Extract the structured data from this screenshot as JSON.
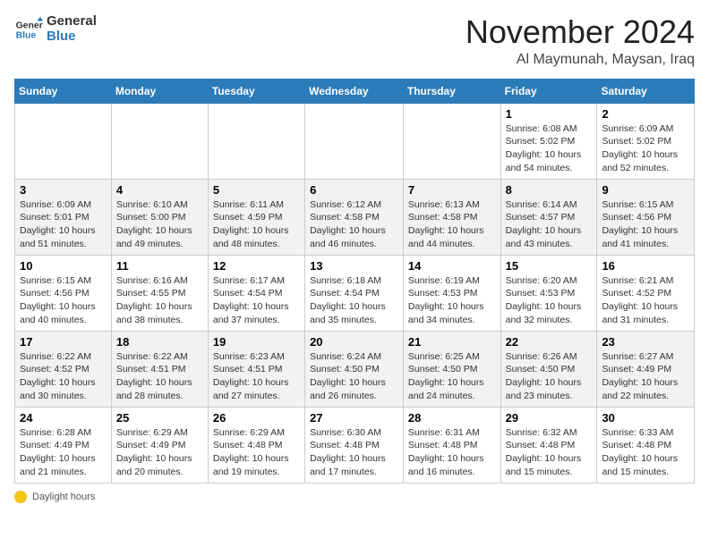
{
  "logo": {
    "line1": "General",
    "line2": "Blue"
  },
  "title": "November 2024",
  "location": "Al Maymunah, Maysan, Iraq",
  "days_of_week": [
    "Sunday",
    "Monday",
    "Tuesday",
    "Wednesday",
    "Thursday",
    "Friday",
    "Saturday"
  ],
  "footer": {
    "icon_label": "sun-icon",
    "text": "Daylight hours"
  },
  "weeks": [
    {
      "days": [
        {
          "num": "",
          "info": ""
        },
        {
          "num": "",
          "info": ""
        },
        {
          "num": "",
          "info": ""
        },
        {
          "num": "",
          "info": ""
        },
        {
          "num": "",
          "info": ""
        },
        {
          "num": "1",
          "info": "Sunrise: 6:08 AM\nSunset: 5:02 PM\nDaylight: 10 hours and 54 minutes."
        },
        {
          "num": "2",
          "info": "Sunrise: 6:09 AM\nSunset: 5:02 PM\nDaylight: 10 hours and 52 minutes."
        }
      ]
    },
    {
      "days": [
        {
          "num": "3",
          "info": "Sunrise: 6:09 AM\nSunset: 5:01 PM\nDaylight: 10 hours and 51 minutes."
        },
        {
          "num": "4",
          "info": "Sunrise: 6:10 AM\nSunset: 5:00 PM\nDaylight: 10 hours and 49 minutes."
        },
        {
          "num": "5",
          "info": "Sunrise: 6:11 AM\nSunset: 4:59 PM\nDaylight: 10 hours and 48 minutes."
        },
        {
          "num": "6",
          "info": "Sunrise: 6:12 AM\nSunset: 4:58 PM\nDaylight: 10 hours and 46 minutes."
        },
        {
          "num": "7",
          "info": "Sunrise: 6:13 AM\nSunset: 4:58 PM\nDaylight: 10 hours and 44 minutes."
        },
        {
          "num": "8",
          "info": "Sunrise: 6:14 AM\nSunset: 4:57 PM\nDaylight: 10 hours and 43 minutes."
        },
        {
          "num": "9",
          "info": "Sunrise: 6:15 AM\nSunset: 4:56 PM\nDaylight: 10 hours and 41 minutes."
        }
      ]
    },
    {
      "days": [
        {
          "num": "10",
          "info": "Sunrise: 6:15 AM\nSunset: 4:56 PM\nDaylight: 10 hours and 40 minutes."
        },
        {
          "num": "11",
          "info": "Sunrise: 6:16 AM\nSunset: 4:55 PM\nDaylight: 10 hours and 38 minutes."
        },
        {
          "num": "12",
          "info": "Sunrise: 6:17 AM\nSunset: 4:54 PM\nDaylight: 10 hours and 37 minutes."
        },
        {
          "num": "13",
          "info": "Sunrise: 6:18 AM\nSunset: 4:54 PM\nDaylight: 10 hours and 35 minutes."
        },
        {
          "num": "14",
          "info": "Sunrise: 6:19 AM\nSunset: 4:53 PM\nDaylight: 10 hours and 34 minutes."
        },
        {
          "num": "15",
          "info": "Sunrise: 6:20 AM\nSunset: 4:53 PM\nDaylight: 10 hours and 32 minutes."
        },
        {
          "num": "16",
          "info": "Sunrise: 6:21 AM\nSunset: 4:52 PM\nDaylight: 10 hours and 31 minutes."
        }
      ]
    },
    {
      "days": [
        {
          "num": "17",
          "info": "Sunrise: 6:22 AM\nSunset: 4:52 PM\nDaylight: 10 hours and 30 minutes."
        },
        {
          "num": "18",
          "info": "Sunrise: 6:22 AM\nSunset: 4:51 PM\nDaylight: 10 hours and 28 minutes."
        },
        {
          "num": "19",
          "info": "Sunrise: 6:23 AM\nSunset: 4:51 PM\nDaylight: 10 hours and 27 minutes."
        },
        {
          "num": "20",
          "info": "Sunrise: 6:24 AM\nSunset: 4:50 PM\nDaylight: 10 hours and 26 minutes."
        },
        {
          "num": "21",
          "info": "Sunrise: 6:25 AM\nSunset: 4:50 PM\nDaylight: 10 hours and 24 minutes."
        },
        {
          "num": "22",
          "info": "Sunrise: 6:26 AM\nSunset: 4:50 PM\nDaylight: 10 hours and 23 minutes."
        },
        {
          "num": "23",
          "info": "Sunrise: 6:27 AM\nSunset: 4:49 PM\nDaylight: 10 hours and 22 minutes."
        }
      ]
    },
    {
      "days": [
        {
          "num": "24",
          "info": "Sunrise: 6:28 AM\nSunset: 4:49 PM\nDaylight: 10 hours and 21 minutes."
        },
        {
          "num": "25",
          "info": "Sunrise: 6:29 AM\nSunset: 4:49 PM\nDaylight: 10 hours and 20 minutes."
        },
        {
          "num": "26",
          "info": "Sunrise: 6:29 AM\nSunset: 4:48 PM\nDaylight: 10 hours and 19 minutes."
        },
        {
          "num": "27",
          "info": "Sunrise: 6:30 AM\nSunset: 4:48 PM\nDaylight: 10 hours and 17 minutes."
        },
        {
          "num": "28",
          "info": "Sunrise: 6:31 AM\nSunset: 4:48 PM\nDaylight: 10 hours and 16 minutes."
        },
        {
          "num": "29",
          "info": "Sunrise: 6:32 AM\nSunset: 4:48 PM\nDaylight: 10 hours and 15 minutes."
        },
        {
          "num": "30",
          "info": "Sunrise: 6:33 AM\nSunset: 4:48 PM\nDaylight: 10 hours and 15 minutes."
        }
      ]
    }
  ]
}
